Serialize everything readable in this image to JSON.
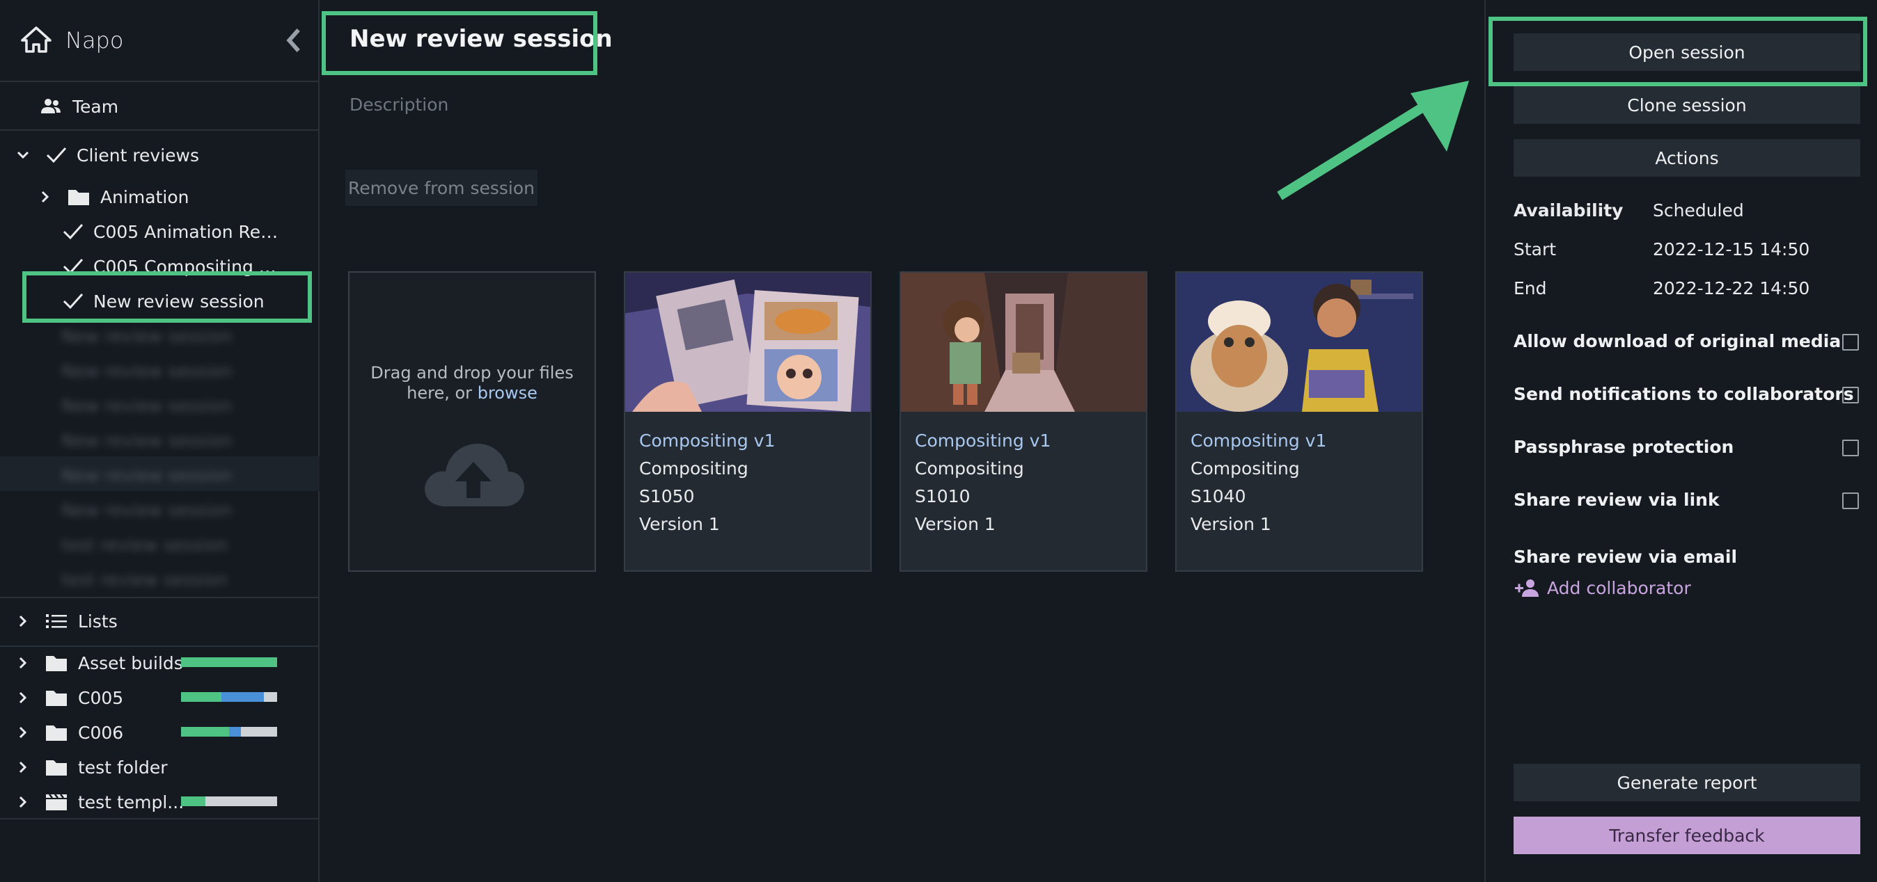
{
  "app": {
    "name": "Napo"
  },
  "sidebar": {
    "team_label": "Team",
    "client_reviews_label": "Client reviews",
    "animation_label": "Animation",
    "sessions": [
      {
        "label": "C005 Animation Revie..."
      },
      {
        "label": "C005 Compositing Re..."
      },
      {
        "label": "New review session"
      }
    ],
    "blurred_sessions": [
      "New review session",
      "New review session",
      "New review session",
      "New review session",
      "New review session",
      "New review session",
      "test review session",
      "test review session"
    ],
    "lists_label": "Lists",
    "projects": [
      {
        "label": "Asset builds",
        "progress": [
          {
            "color": "#4fc383",
            "fraction": 1.0
          }
        ]
      },
      {
        "label": "C005",
        "progress": [
          {
            "color": "#4fc383",
            "fraction": 0.42
          },
          {
            "color": "#4a90d9",
            "fraction": 0.44
          }
        ]
      },
      {
        "label": "C006",
        "progress": [
          {
            "color": "#4fc383",
            "fraction": 0.5
          },
          {
            "color": "#4a90d9",
            "fraction": 0.12
          }
        ]
      },
      {
        "label": "test folder",
        "progress": []
      },
      {
        "label": "test templ...",
        "progress": [
          {
            "color": "#4fc383",
            "fraction": 0.25
          }
        ]
      }
    ]
  },
  "main": {
    "title": "New review session",
    "description_placeholder": "Description",
    "remove_button": "Remove from session",
    "dropzone_text": "Drag and drop your files here, or ",
    "dropzone_link": "browse",
    "cards": [
      {
        "name": "Compositing v1",
        "type": "Compositing",
        "shot": "S1050",
        "version": "Version 1"
      },
      {
        "name": "Compositing v1",
        "type": "Compositing",
        "shot": "S1010",
        "version": "Version 1"
      },
      {
        "name": "Compositing v1",
        "type": "Compositing",
        "shot": "S1040",
        "version": "Version 1"
      }
    ]
  },
  "panel": {
    "open_session": "Open session",
    "clone_session": "Clone session",
    "actions": "Actions",
    "availability_label": "Availability",
    "availability_value": "Scheduled",
    "start_label": "Start",
    "start_value": "2022-12-15 14:50",
    "end_label": "End",
    "end_value": "2022-12-22 14:50",
    "options": [
      "Allow download of original media",
      "Send notifications to collaborators",
      "Passphrase protection",
      "Share review via link"
    ],
    "share_email_label": "Share review via email",
    "add_collaborator": "Add collaborator",
    "generate_report": "Generate report",
    "transfer_feedback": "Transfer feedback"
  },
  "colors": {
    "accent_green": "#4fc383",
    "accent_purple": "#c39fd5",
    "link_blue": "#a8c8f0"
  }
}
